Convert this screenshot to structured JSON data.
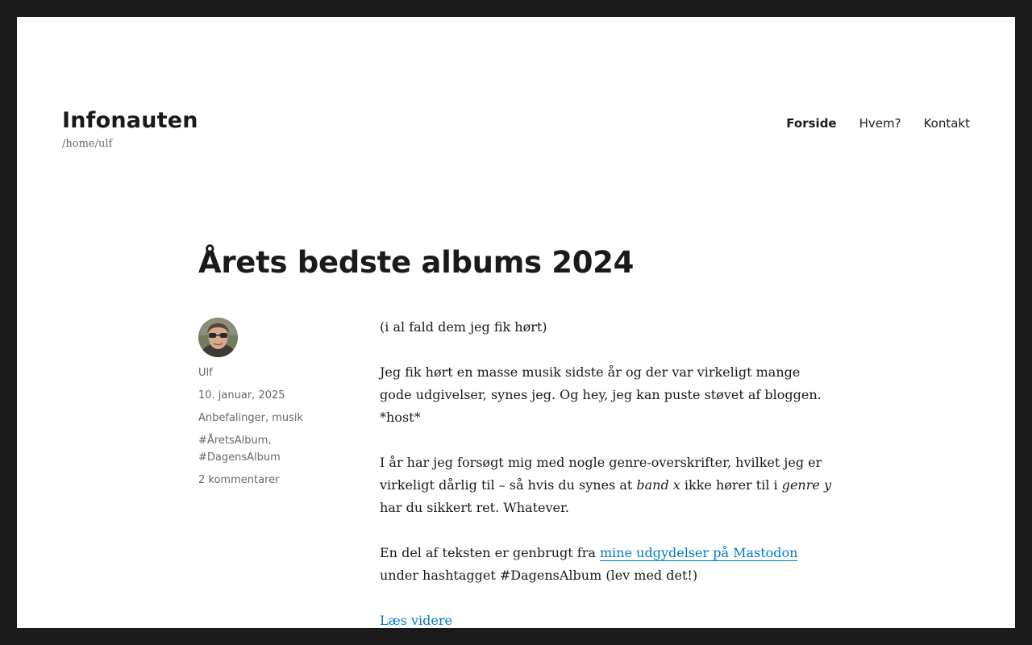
{
  "site": {
    "title": "Infonauten",
    "description": "/home/ulf"
  },
  "nav": {
    "items": [
      {
        "label": "Forside",
        "current": true
      },
      {
        "label": "Hvem?",
        "current": false
      },
      {
        "label": "Kontakt",
        "current": false
      }
    ]
  },
  "post": {
    "title": "Årets bedste albums 2024",
    "meta": {
      "author": "Ulf",
      "date": "10. januar, 2025",
      "category_1": "Anbefalinger",
      "category_sep": ", ",
      "category_2": "musik",
      "tag_1": "#ÅretsAlbum,",
      "tag_2": "#DagensAlbum",
      "comments": "2 kommentarer"
    },
    "content": {
      "p1": "(i al fald dem jeg fik hørt)",
      "p2": "Jeg fik hørt en masse musik sidste år og der var virkeligt mange gode udgivelser, synes jeg. Og hey, jeg kan puste støvet af bloggen. *host*",
      "p3_a": "I år har jeg forsøgt mig med nogle genre-overskrifter, hvilket jeg er virkeligt dårlig til – så hvis du synes at ",
      "p3_em1": "band x",
      "p3_b": " ikke hører til i ",
      "p3_em2": "genre y",
      "p3_c": " har du sikkert ret. Whatever.",
      "p4_a": "En del af teksten er genbrugt fra ",
      "p4_link": "mine udgydelser på Mastodon",
      "p4_b": " under hashtagget #DagensAlbum (lev med det!)",
      "read_more": "Læs videre"
    }
  }
}
